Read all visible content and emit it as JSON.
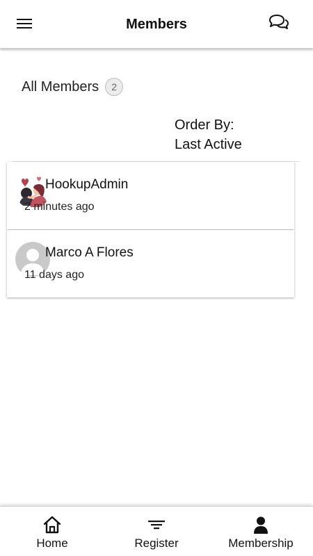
{
  "header": {
    "title": "Members",
    "menu_icon": "hamburger-menu-icon",
    "chat_icon": "chat-bubbles-icon"
  },
  "members_section": {
    "label": "All Members",
    "count": "2",
    "order_by_label": "Order By:",
    "order_by_value": "Last Active"
  },
  "members": [
    {
      "name": "HookupAdmin",
      "last_active": "2 minutes ago",
      "avatar": "couple-hearts-avatar"
    },
    {
      "name": "Marco A Flores",
      "last_active": "11 days ago",
      "avatar": "default-user-avatar"
    }
  ],
  "bottom_nav": {
    "items": [
      {
        "label": "Home",
        "icon": "home-icon"
      },
      {
        "label": "Register",
        "icon": "filter-lines-icon"
      },
      {
        "label": "Membership",
        "icon": "user-silhouette-icon"
      }
    ]
  },
  "colors": {
    "background": "#ffffff",
    "text": "#111111",
    "badge_bg": "#ececec"
  }
}
